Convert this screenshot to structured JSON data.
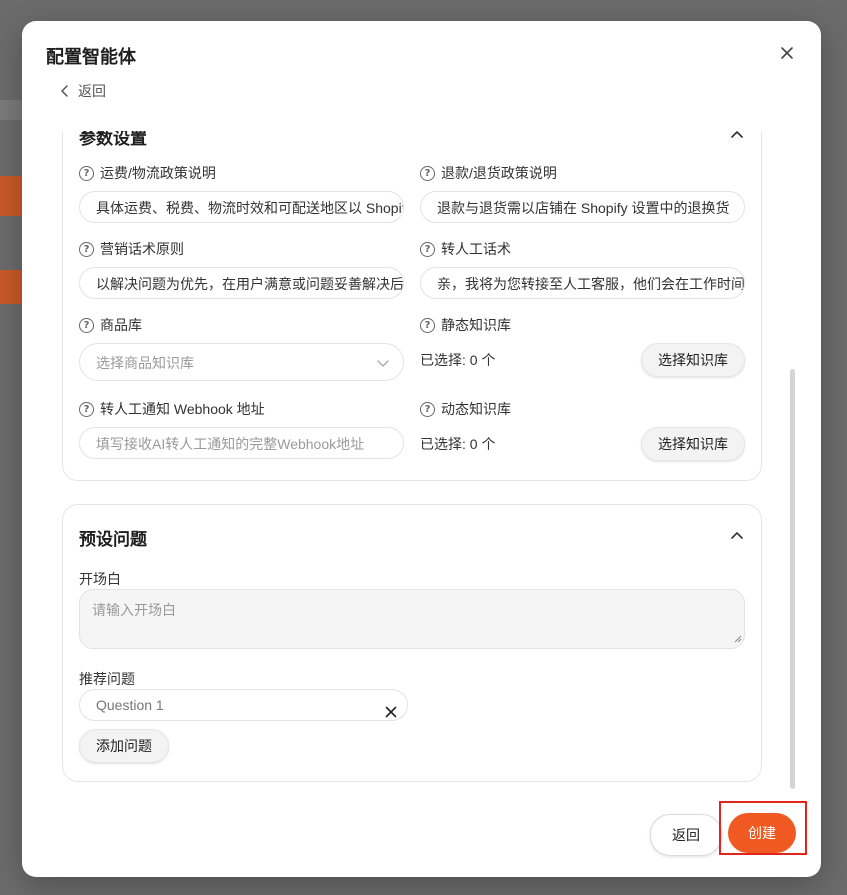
{
  "modal": {
    "title": "配置智能体",
    "back_label": "返回"
  },
  "params_section": {
    "title": "参数设置",
    "fields": {
      "shipping": {
        "label": "运费/物流政策说明",
        "value": "具体运费、税费、物流时效和可配送地区以 Shopify"
      },
      "refund": {
        "label": "退款/退货政策说明",
        "value": "退款与退货需以店铺在 Shopify 设置中的退换货"
      },
      "marketing": {
        "label": "营销话术原则",
        "value": "以解决问题为优先，在用户满意或问题妥善解决后"
      },
      "handoff": {
        "label": "转人工话术",
        "value": "亲，我将为您转接至人工客服，他们会在工作时间"
      },
      "product_lib": {
        "label": "商品库",
        "placeholder": "选择商品知识库"
      },
      "static_kb": {
        "label": "静态知识库",
        "selected": "已选择: 0 个",
        "button": "选择知识库"
      },
      "webhook": {
        "label": "转人工通知 Webhook 地址",
        "placeholder": "填写接收AI转人工通知的完整Webhook地址"
      },
      "dynamic_kb": {
        "label": "动态知识库",
        "selected": "已选择: 0 个",
        "button": "选择知识库"
      }
    }
  },
  "preset_section": {
    "title": "预设问题",
    "opening_label": "开场白",
    "opening_placeholder": "请输入开场白",
    "recommend_label": "推荐问题",
    "questions": [
      {
        "value": "Question 1"
      }
    ],
    "add_button": "添加问题"
  },
  "footer": {
    "back_label": "返回",
    "create_label": "创建"
  },
  "colors": {
    "accent": "#f05a22",
    "highlight_outline": "#e1251b",
    "overlay": "#6b6b6b"
  }
}
